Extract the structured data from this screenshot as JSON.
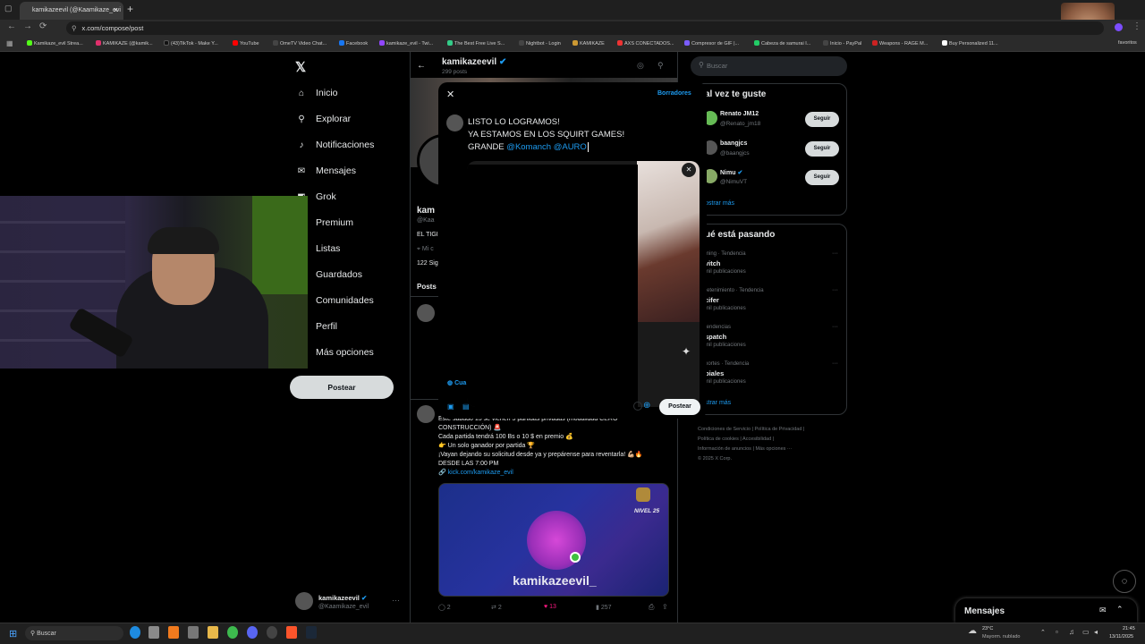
{
  "browser": {
    "tab_title": "kamikazeevil (@Kaamikaze_evi",
    "url": "x.com/compose/post",
    "bookmarks": [
      "Kamikaze_evil Strea...",
      "KAMIKAZE (@kamik...",
      "(43)TikTok - Make Y...",
      "YouTube",
      "OmeTV Video Chat...",
      "Facebook",
      "kamikaze_evil - Twi...",
      "The Best Free Live S...",
      "Nightbot - Login",
      "KAMIKAZE",
      "AXS CONECTADOS...",
      "Compresor de GIF |...",
      "Cabeza de samurai I...",
      "Inicio - PayPal",
      "Weapons - RAGE M...",
      "Buy Personalized 11..."
    ],
    "bookmarks_more": "favoritos",
    "overlay_badge": "x16"
  },
  "sidebar": {
    "items": [
      {
        "label": "Inicio",
        "icon": "home-icon"
      },
      {
        "label": "Explorar",
        "icon": "search-icon"
      },
      {
        "label": "Notificaciones",
        "icon": "bell-icon"
      },
      {
        "label": "Mensajes",
        "icon": "mail-icon"
      },
      {
        "label": "Grok",
        "icon": "grok-icon"
      },
      {
        "label": "Premium",
        "icon": "x-icon"
      },
      {
        "label": "Listas",
        "icon": "list-icon"
      },
      {
        "label": "Guardados",
        "icon": "bookmark-icon"
      },
      {
        "label": "Comunidades",
        "icon": "people-icon"
      },
      {
        "label": "Perfil",
        "icon": "person-icon"
      },
      {
        "label": "Más opciones",
        "icon": "more-icon"
      }
    ],
    "post_button": "Postear",
    "account_name": "kamikazeevil",
    "account_handle": "@Kaamikaze_evil"
  },
  "profile": {
    "name": "kamikazeevil",
    "posts_count": "299 posts",
    "partial_name": "kam",
    "partial_handle": "@Kaa",
    "partial_bio": "EL TIGI",
    "partial_location": "Mi c",
    "partial_follow": "122 Sig",
    "tab_posts": "Posts"
  },
  "feed_post": {
    "lines": [
      "Este sábado 15 se vienen 5 partidas privadas (modalidad CERO",
      "CONSTRUCCIÓN) 🚨",
      "Cada partida tendrá 100 Bs o 10 $ en premio 💰",
      "👉 Un solo ganador por partida 🏆",
      "¡Vayan dejando su solicitud desde ya y prepárense para reventarla! 💪🏼🔥",
      "DESDE LAS 7:00 PM"
    ],
    "link": "🔗 kick.com/kamikaze_evil",
    "card_name": "kamikazeevil_",
    "card_level": "NIVEL 25",
    "stats": {
      "replies": "2",
      "reposts": "2",
      "likes": "13",
      "views": "257"
    }
  },
  "compose": {
    "drafts": "Borradores",
    "line1": "LISTO LO LOGRAMOS!",
    "line2": "YA ESTAMOS EN LOS SQUIRT GAMES!",
    "line3_prefix": "GRANDE ",
    "mention1": "@Komanch",
    "mention2": "@AURO",
    "reply_setting": "Cua",
    "post_button": "Postear"
  },
  "right": {
    "search_placeholder": "Buscar",
    "who_to_follow_title": "al vez te guste",
    "follow_label": "Seguir",
    "suggestions": [
      {
        "name": "Renato JM12",
        "handle": "@Renato_jm18"
      },
      {
        "name": "baangjcs",
        "handle": "@baangjcs"
      },
      {
        "name": "Nimu",
        "handle": "@NimuVT"
      }
    ],
    "show_more": "ostrar más",
    "trends_title": "ué está pasando",
    "trends": [
      {
        "context": "ming · Tendencia",
        "name": "vitch",
        "count": "mil publicaciones"
      },
      {
        "context": "retenimiento · Tendencia",
        "name": "cifer",
        "count": "mil publicaciones"
      },
      {
        "context": "tendencias",
        "name": "spatch",
        "count": "mil publicaciones"
      },
      {
        "context": "portes · Tendencia",
        "name": "biales",
        "count": "mil publicaciones"
      }
    ],
    "trends_more": "strar más",
    "footer": [
      "Condiciones de Servicio",
      "Política de Privacidad",
      "Política de cookies",
      "Accesibilidad",
      "Información de anuncios",
      "Más opciones ···",
      "© 2025 X Corp."
    ]
  },
  "messages_dock": {
    "title": "Mensajes"
  },
  "taskbar": {
    "search": "Buscar",
    "weather_temp": "23°C",
    "weather_desc": "Mayorm. nublado",
    "time": "21:45",
    "date": "13/11/2025"
  },
  "colors": {
    "accent": "#1d9bf0",
    "like": "#f91880"
  }
}
